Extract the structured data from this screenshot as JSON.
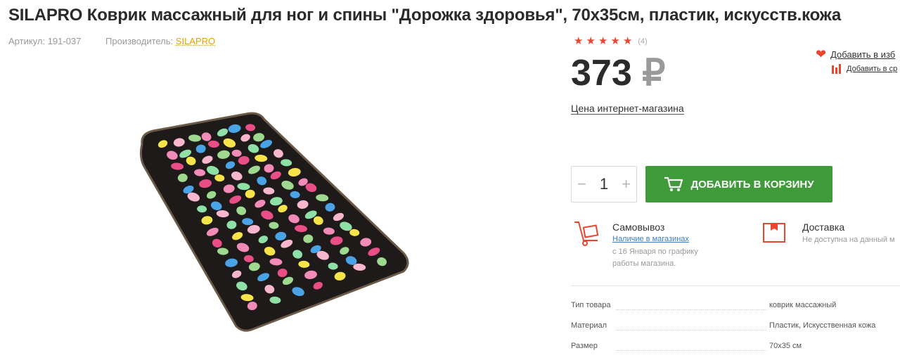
{
  "product": {
    "title": "SILAPRO Коврик массажный для ног и спины \"Дорожка здоровья\", 70х35см, пластик, искусств.кожа",
    "sku_label": "Артикул: 191-037",
    "manufacturer_label": "Производитель:",
    "manufacturer": "SILAPRO"
  },
  "rating": {
    "stars": 5,
    "count": "(4)"
  },
  "price": {
    "value": "373",
    "currency": "₽",
    "note": "Цена интернет-магазина"
  },
  "actions": {
    "wishlist": "Добавить в изб",
    "compare": "Добавить в ср"
  },
  "cart": {
    "quantity": "1",
    "minus": "−",
    "plus": "+",
    "button_label": "Добавить в корзину"
  },
  "delivery": {
    "pickup": {
      "title": "Самовывоз",
      "link": "Наличие в магазинах",
      "line1": "с 16 Января по графику",
      "line2": "работы магазина."
    },
    "courier": {
      "title": "Доставка",
      "note": "Не доступна на данный м"
    }
  },
  "specs": [
    {
      "key": "Тип товара",
      "value": "коврик массажный"
    },
    {
      "key": "Материал",
      "value": "Пластик, Искусственная кожа"
    },
    {
      "key": "Размер",
      "value": "70х35 см"
    }
  ],
  "colors": {
    "accent_red": "#e8462f",
    "cart_green": "#3f9b3a",
    "link_blue": "#3b7fc4",
    "maker_orange": "#e8a200"
  }
}
